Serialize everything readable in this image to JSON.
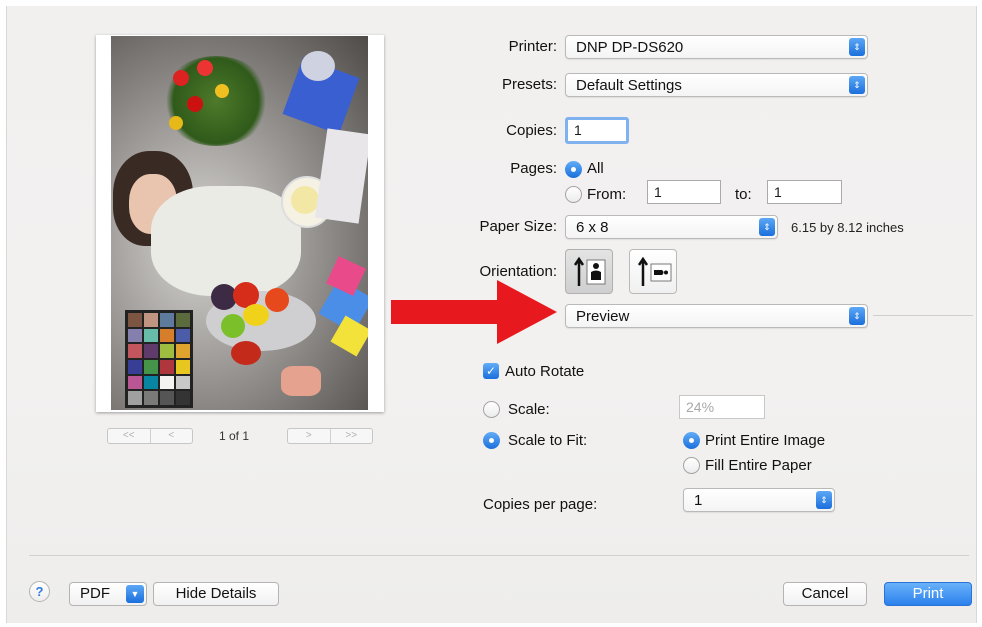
{
  "printer": {
    "label": "Printer:",
    "value": "DNP DP-DS620"
  },
  "presets": {
    "label": "Presets:",
    "value": "Default Settings"
  },
  "copies": {
    "label": "Copies:",
    "value": "1"
  },
  "pages": {
    "label": "Pages:",
    "all_label": "All",
    "from_label": "From:",
    "from_value": "1",
    "to_label": "to:",
    "to_value": "1"
  },
  "paper_size": {
    "label": "Paper Size:",
    "value": "6 x 8",
    "dimensions": "6.15 by 8.12 inches"
  },
  "orientation": {
    "label": "Orientation:"
  },
  "section_popup": {
    "value": "Preview"
  },
  "preview_options": {
    "auto_rotate": "Auto Rotate",
    "scale_label": "Scale:",
    "scale_value": "24%",
    "scale_to_fit": "Scale to Fit:",
    "print_entire_image": "Print Entire Image",
    "fill_entire_paper": "Fill Entire Paper",
    "copies_per_page_label": "Copies per page:",
    "copies_per_page_value": "1"
  },
  "preview_nav": {
    "page_indicator": "1 of 1",
    "first": "<<",
    "prev": "<",
    "next": ">",
    "last": ">>"
  },
  "footer": {
    "help": "?",
    "pdf": "PDF",
    "hide_details": "Hide Details",
    "cancel": "Cancel",
    "print": "Print"
  },
  "colors": {
    "accent": "#1b6fdc",
    "arrow": "#e8191e"
  }
}
